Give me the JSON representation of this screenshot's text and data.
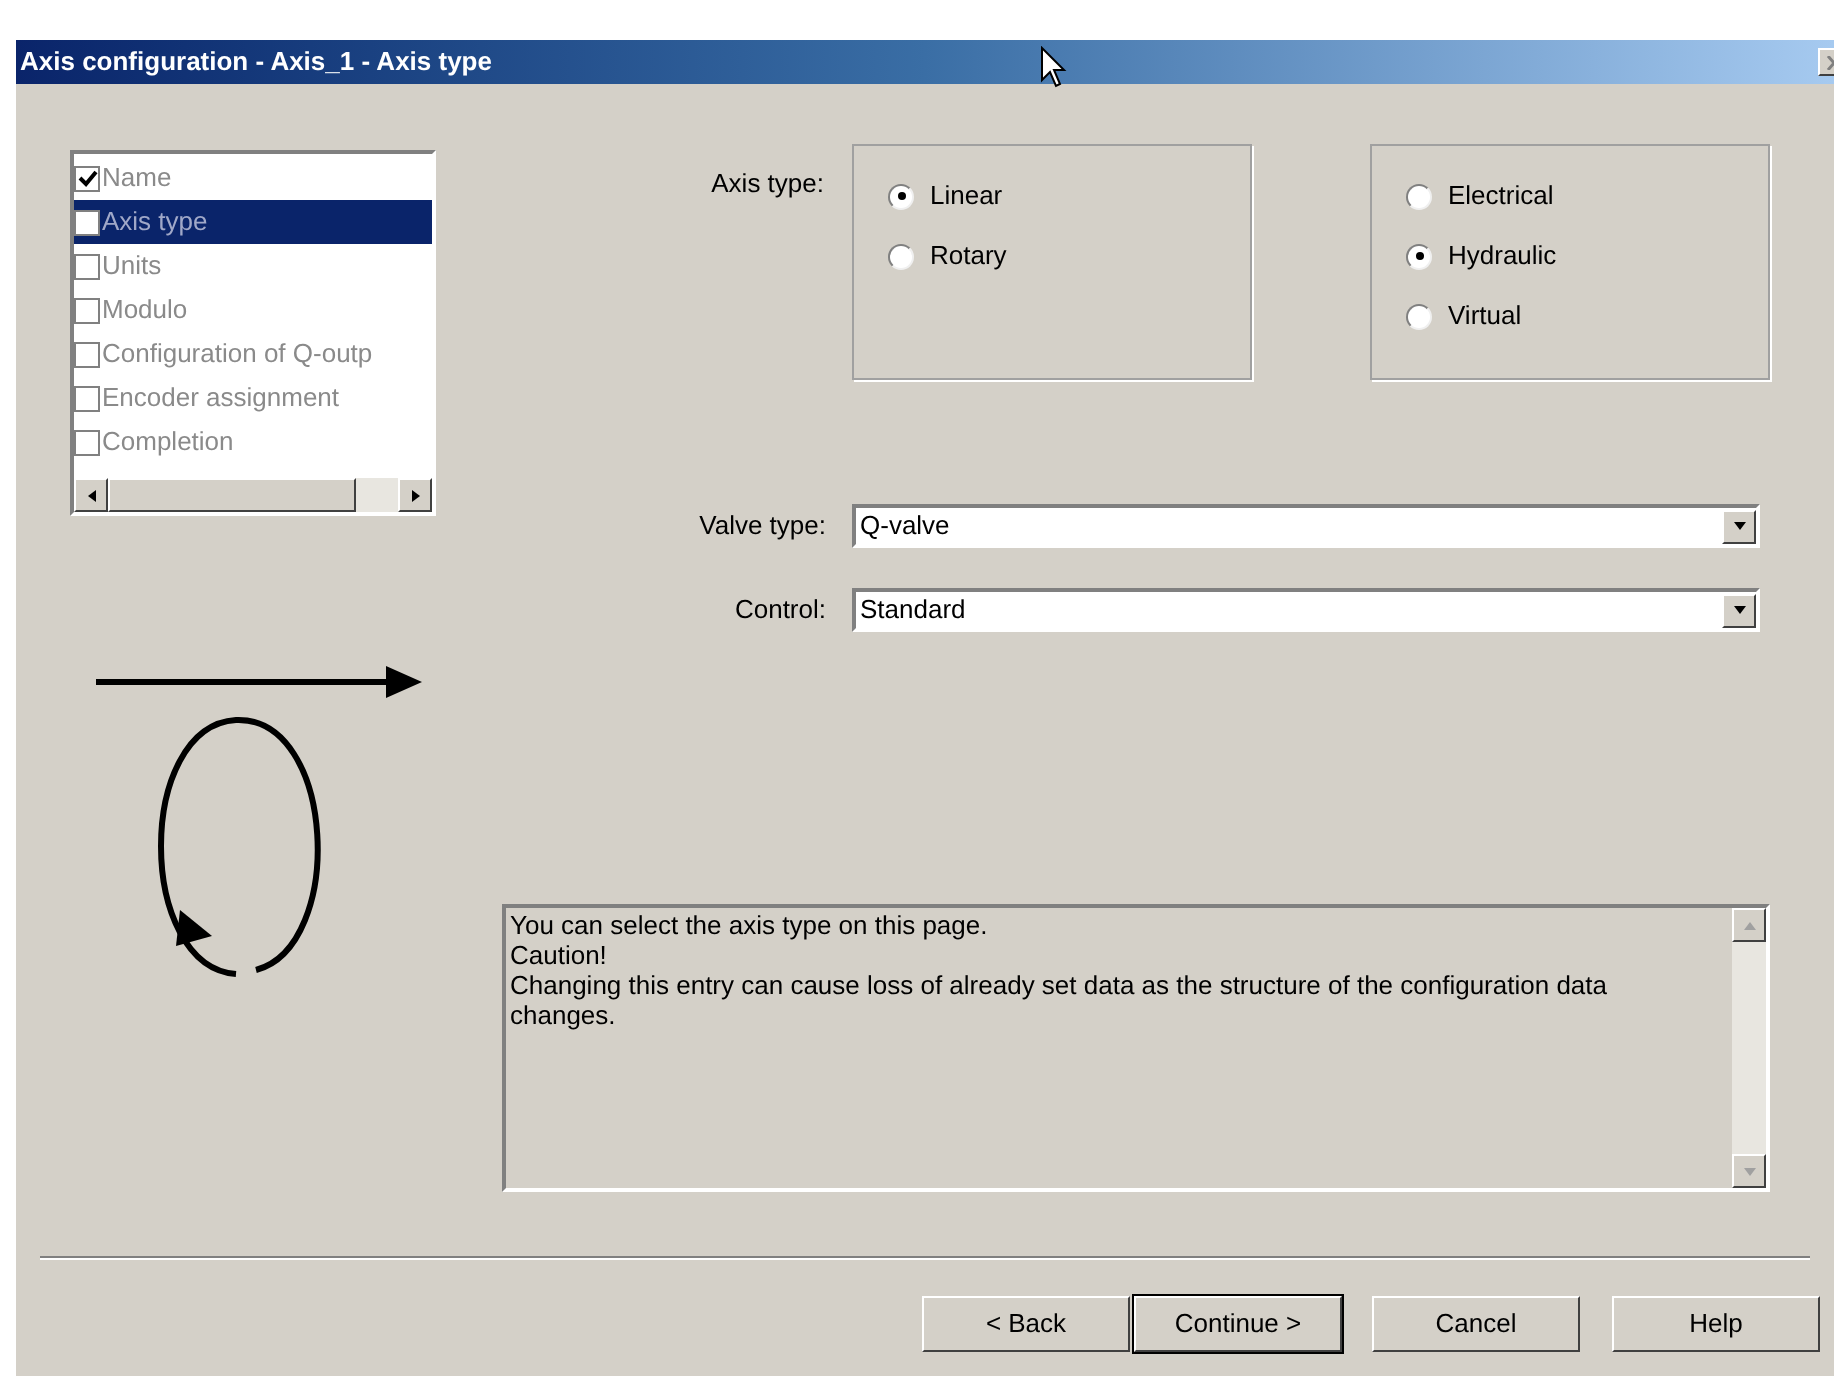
{
  "window": {
    "title": "Axis configuration - Axis_1 - Axis type"
  },
  "steps": [
    {
      "label": "Name",
      "checked": true,
      "selected": false
    },
    {
      "label": "Axis type",
      "checked": false,
      "selected": true
    },
    {
      "label": "Units",
      "checked": false,
      "selected": false
    },
    {
      "label": "Modulo",
      "checked": false,
      "selected": false
    },
    {
      "label": "Configuration of Q-outp",
      "checked": false,
      "selected": false
    },
    {
      "label": "Encoder assignment",
      "checked": false,
      "selected": false
    },
    {
      "label": "Completion",
      "checked": false,
      "selected": false
    }
  ],
  "axis_type": {
    "label": "Axis type:",
    "groups": [
      [
        {
          "label": "Linear",
          "selected": true
        },
        {
          "label": "Rotary",
          "selected": false
        }
      ],
      [
        {
          "label": "Electrical",
          "selected": false
        },
        {
          "label": "Hydraulic",
          "selected": true
        },
        {
          "label": "Virtual",
          "selected": false
        }
      ]
    ]
  },
  "fields": [
    {
      "label": "Valve type:",
      "value": "Q-valve"
    },
    {
      "label": "Control:",
      "value": "Standard"
    }
  ],
  "description": [
    "You can select the axis type on this page.",
    "Caution!",
    "Changing this entry can cause loss of already set data as the structure of the configuration data changes."
  ],
  "buttons": [
    {
      "label": "< Back",
      "default": false
    },
    {
      "label": "Continue >",
      "default": true
    },
    {
      "label": "Cancel",
      "default": false
    },
    {
      "label": "Help",
      "default": false
    }
  ]
}
